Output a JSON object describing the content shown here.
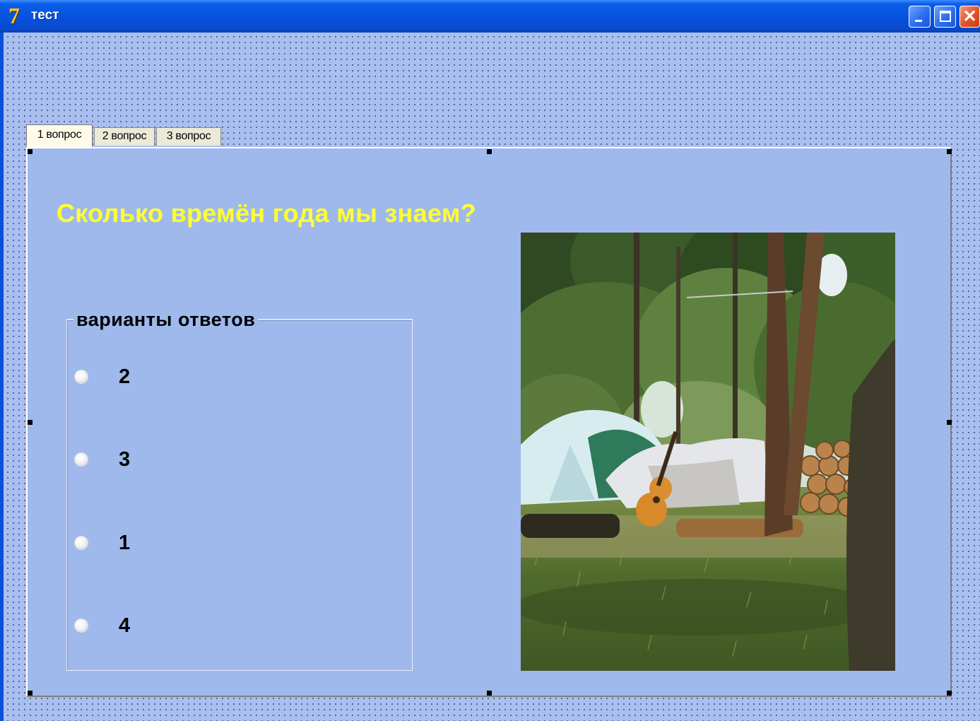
{
  "window": {
    "title": "тест",
    "icon": "delphi-app-icon",
    "controls": [
      "minimize-button",
      "maximize-button",
      "close-button"
    ]
  },
  "tabs": [
    {
      "label": "1 вопрос",
      "active": true
    },
    {
      "label": "2 вопрос",
      "active": false
    },
    {
      "label": "3 вопрос",
      "active": false
    }
  ],
  "question": {
    "text": "Сколько времён года мы знаем?"
  },
  "answers": {
    "caption": "варианты ответов",
    "options": [
      {
        "label": "2",
        "selected": false
      },
      {
        "label": "3",
        "selected": false
      },
      {
        "label": "1",
        "selected": false
      },
      {
        "label": "4",
        "selected": false
      }
    ]
  },
  "image": {
    "subject": "campsite-tent-guitar-forest-photo"
  },
  "colors": {
    "titlebar": "#0552e0",
    "form_background": "#a9bff0",
    "page_background": "#9fb9ec",
    "question_text": "#ffff33"
  }
}
